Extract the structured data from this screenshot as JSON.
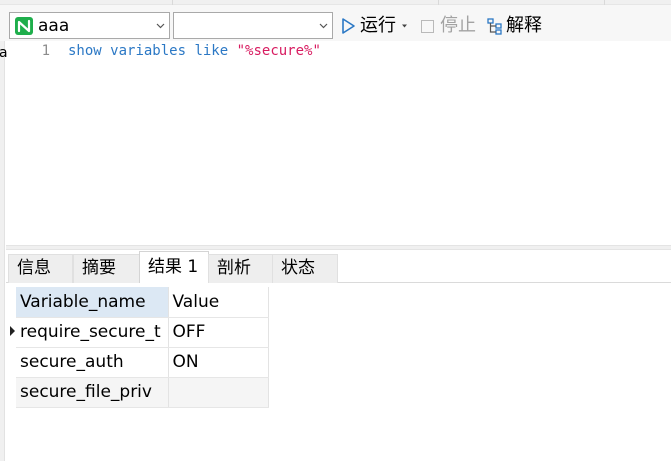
{
  "toolbar": {
    "connection_select": {
      "value": "aaa",
      "icon": "navicat-connection-icon",
      "icon_color": "#1eae4b"
    },
    "database_select": {
      "value": ""
    },
    "run_button": {
      "label": "运行",
      "icon": "play-icon",
      "icon_color": "#2b78c5"
    },
    "stop_button": {
      "label": "停止",
      "icon": "stop-icon"
    },
    "explain_button": {
      "label": "解释",
      "icon": "explain-icon"
    }
  },
  "left_strip": {
    "letter": "a"
  },
  "editor": {
    "line_numbers": [
      "1"
    ],
    "code": {
      "keyword_show": "show",
      "keyword_variables": "variables",
      "keyword_like": "like",
      "string_literal": "\"%secure%\""
    },
    "colors": {
      "keyword": "#2b78c5",
      "string": "#d81b60"
    }
  },
  "tabs": [
    {
      "label": "信息",
      "active": false
    },
    {
      "label": "摘要",
      "active": false
    },
    {
      "label": "结果 1",
      "active": true
    },
    {
      "label": "剖析",
      "active": false
    },
    {
      "label": "状态",
      "active": false
    }
  ],
  "results": {
    "columns": [
      "Variable_name",
      "Value"
    ],
    "rows": [
      [
        "require_secure_t",
        "OFF"
      ],
      [
        "secure_auth",
        "ON"
      ],
      [
        "secure_file_priv",
        ""
      ]
    ],
    "selected_row": 0,
    "header_highlight": "#dce8f4"
  }
}
